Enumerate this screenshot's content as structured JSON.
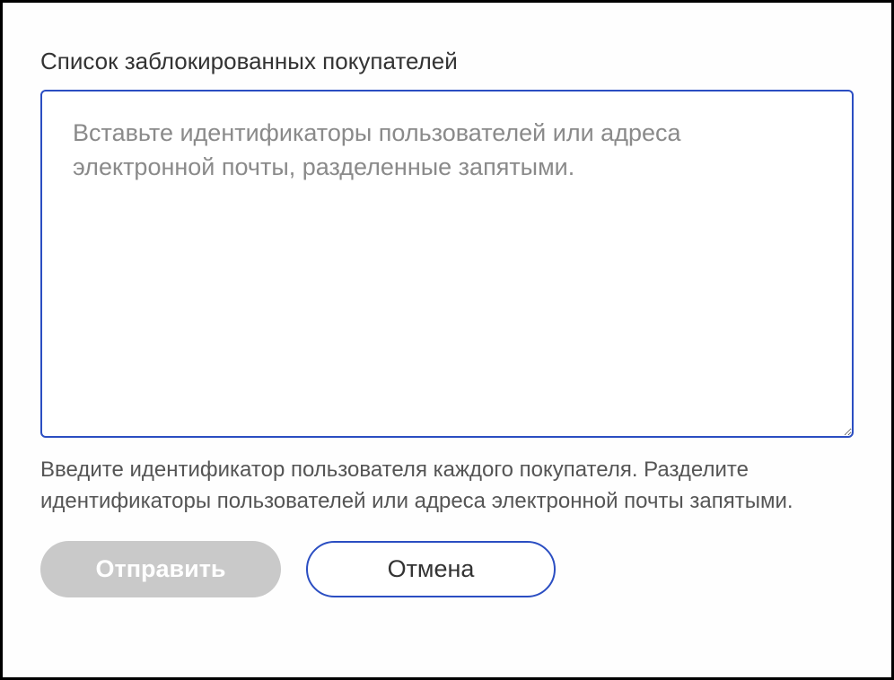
{
  "form": {
    "label": "Список заблокированных покупателей",
    "placeholder": "Вставьте идентификаторы пользователей или адреса электронной почты, разделенные запятыми.",
    "value": "",
    "helper": "Введите идентификатор пользователя каждого покупателя. Разделите идентификаторы пользователей или адреса электронной почты запятыми."
  },
  "buttons": {
    "submit": "Отправить",
    "cancel": "Отмена"
  }
}
